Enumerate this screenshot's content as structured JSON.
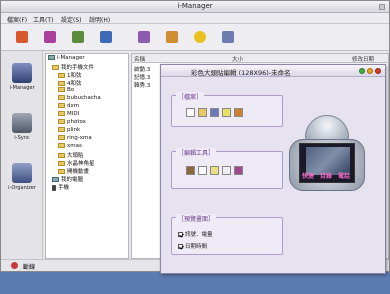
{
  "app": {
    "title": "i-Manager"
  },
  "menu": [
    "檔案(F)",
    "工具(T)",
    "設定(S)",
    "說明(H)"
  ],
  "toolbar": [
    "open-phone-icon",
    "phonebook-icon",
    "image-icon",
    "send-icon",
    "settings-icon",
    "manual-icon",
    "help-icon",
    "exit-icon"
  ],
  "sidebar": [
    {
      "label": "i-Manager",
      "icon": "phone-manager-icon"
    },
    {
      "label": "i-Sync",
      "icon": "sync-icon"
    },
    {
      "label": "i-Organizer",
      "icon": "organizer-icon"
    }
  ],
  "tree": {
    "root": "i-Manager",
    "phone_docs": "我的手機文件",
    "items": [
      "1和弦",
      "4和弦",
      "Bo",
      "bubuchacha",
      "dxm",
      "MIDI",
      "photos",
      "plink",
      "ring-xma",
      "xmas",
      "大頭貼",
      "水晶神角星",
      "開機動畫"
    ],
    "my_computer": "我的電腦",
    "phone": "手機"
  },
  "filelist": {
    "headers": [
      "名稱",
      "大小",
      "修改日期"
    ],
    "rows": [
      "啟動.3",
      "記憶.3",
      "韓秀.3"
    ]
  },
  "status": {
    "label": "斷線"
  },
  "dialog": {
    "title": "彩色大頭貼編輯 (128X96)-未命名",
    "file_panel": "檔案",
    "edit_panel": "編輯工具",
    "preview_panel": "預覽畫面",
    "options": [
      "訊號．電量",
      "日期時間"
    ],
    "softkeys": [
      "快捷",
      "目錄",
      "電話"
    ]
  }
}
